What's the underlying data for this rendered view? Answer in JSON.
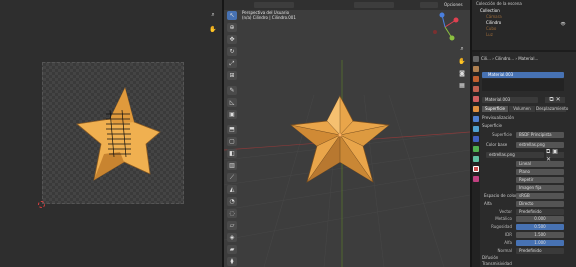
{
  "uv_editor": {
    "stitch_icon": "uv-seam-icon"
  },
  "viewport": {
    "header": {
      "options_label": "Opciones"
    },
    "info": {
      "line1": "Perspectiva del Usuario",
      "line2": "(n/a) Cilindro | Cilindro.001"
    },
    "nav_axes": [
      "X",
      "Y",
      "Z"
    ],
    "tools": [
      "select",
      "cursor",
      "move",
      "rotate",
      "scale",
      "transform",
      "annotate",
      "measure",
      "add-cube",
      "extrude",
      "inset",
      "bevel",
      "loop-cut",
      "knife",
      "poly-build",
      "spin",
      "smooth",
      "edge-slide",
      "shrink",
      "shear",
      "rip"
    ]
  },
  "outliner": {
    "title": "Colección de la escena",
    "rows": [
      {
        "name": "Collection",
        "style": "sel"
      },
      {
        "name": "Cámara",
        "style": "dim"
      },
      {
        "name": "Cilindro",
        "style": "sel"
      },
      {
        "name": "Cubo",
        "style": "dim"
      },
      {
        "name": "Luz",
        "style": "dim"
      }
    ]
  },
  "properties": {
    "breadcrumb": [
      "Cili...",
      "Cilindro...",
      "Material..."
    ],
    "material_slot": "Material.003",
    "material_field": "Material.003",
    "subtabs": [
      "Superficie",
      "Volumen",
      "Desplazamiento"
    ],
    "sections": {
      "preview": "Previsualización",
      "surface": "Superficie",
      "base_color": "Color base",
      "diffusion": "Difusión",
      "transmission": "Transmisividad"
    },
    "surface_shader": "BSDF Principista",
    "texture_name": "estrellas.png",
    "image_name": "estrellas.png",
    "dropdowns": [
      "Lineal",
      "Plano",
      "Repetir",
      "Imagen fija"
    ],
    "color_space_label": "Espacio de color",
    "color_space_value": "sRGB",
    "alpha_label": "Alfa",
    "alpha_value": "Directo",
    "vector_label": "Vector",
    "vector_value": "Predefinido",
    "params": [
      {
        "label": "Metálico",
        "value": "0.000"
      },
      {
        "label": "Rugosidad",
        "value": "0.500"
      },
      {
        "label": "IDR",
        "value": "1.500"
      },
      {
        "label": "Alfa",
        "value": "1.000"
      }
    ],
    "normal_label": "Normal",
    "normal_value": "Predefinido"
  },
  "colors": {
    "accent": "#4772b3",
    "star": "#f0b050",
    "star_shade": "#b87830"
  }
}
